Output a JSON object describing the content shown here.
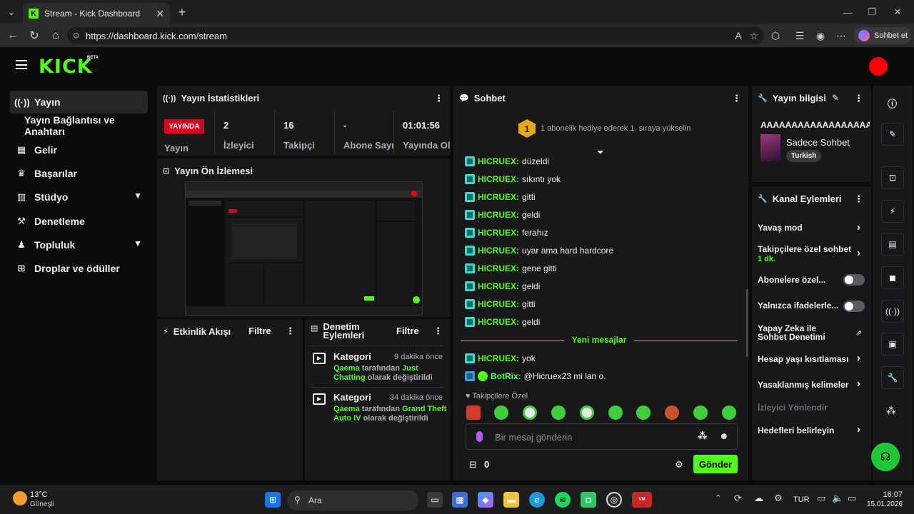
{
  "browser": {
    "tab_title": "Stream - Kick Dashboard",
    "url": "https://dashboard.kick.com/stream",
    "copilot_label": "Sohbet et"
  },
  "app": {
    "logo": "KICK",
    "beta": "BETA",
    "accent": "#53fc18",
    "live_color": "#d9001e"
  },
  "sidebar": {
    "items": [
      {
        "label": "Yayın",
        "icon": "broadcast-icon"
      },
      {
        "label": "Yayın Bağlantısı ve Anahtarı",
        "icon": ""
      },
      {
        "label": "Gelir",
        "icon": "revenue-icon"
      },
      {
        "label": "Başarılar",
        "icon": "trophy-icon"
      },
      {
        "label": "Stüdyo",
        "icon": "studio-icon"
      },
      {
        "label": "Denetleme",
        "icon": "moderation-icon"
      },
      {
        "label": "Topluluk",
        "icon": "community-icon"
      },
      {
        "label": "Droplar ve ödüller",
        "icon": "drops-icon"
      }
    ]
  },
  "stats": {
    "title": "Yayın İstatistikleri",
    "live_badge": "YAYINDA",
    "live_label": "Yayın",
    "items": [
      {
        "value": "2",
        "label": "İzleyici"
      },
      {
        "value": "16",
        "label": "Takipçi"
      },
      {
        "value": "-",
        "label": "Abone Sayısı"
      },
      {
        "value": "01:01:56",
        "label": "Yayında Olduğu"
      }
    ]
  },
  "preview": {
    "title": "Yayın Ön İzlemesi"
  },
  "activity": {
    "title": "Etkinlik Akışı",
    "filter": "Filtre"
  },
  "moderation": {
    "title": "Denetim Eylemleri",
    "filter": "Filtre",
    "events": [
      {
        "type": "Kategori",
        "time": "9 dakika önce",
        "user": "Qaema",
        "mid": "tarafından",
        "target": "Just Chatting",
        "tail": "olarak değiştirildi"
      },
      {
        "type": "Kategori",
        "time": "34 dakika önce",
        "user": "Qaema",
        "mid": "tarafından",
        "target": "Grand Theft Auto IV",
        "tail": "olarak değiştirildi"
      }
    ]
  },
  "chat": {
    "title": "Sohbet",
    "gift_rank": "1",
    "gift_text": "1 abonelik hediye ederek 1. sıraya yükselin",
    "messages": [
      {
        "user": "HICRUEX:",
        "text": "düzeldi"
      },
      {
        "user": "HICRUEX:",
        "text": "sıkıntı yok"
      },
      {
        "user": "HICRUEX:",
        "text": "gitti"
      },
      {
        "user": "HICRUEX:",
        "text": "geldi"
      },
      {
        "user": "HICRUEX:",
        "text": "ferahız"
      },
      {
        "user": "HICRUEX:",
        "text": "uyar ama hard hardcore"
      },
      {
        "user": "HICRUEX:",
        "text": "gene gitti"
      },
      {
        "user": "HICRUEX:",
        "text": "geldi"
      },
      {
        "user": "HICRUEX:",
        "text": "gitti"
      },
      {
        "user": "HICRUEX:",
        "text": "geldi"
      }
    ],
    "new_messages_label": "Yeni mesajlar",
    "new_messages": [
      {
        "user": "HICRUEX:",
        "text": "yok"
      },
      {
        "user": "BotRix:",
        "text": "@Hicruex23 mi lan o."
      }
    ],
    "followers_only": "Takipçilere Özel",
    "input_placeholder": "Bir mesaj gönderin",
    "points": "0",
    "send_label": "Gönder"
  },
  "stream_info": {
    "title": "Yayın bilgisi",
    "stream_title": "AAAAAAAAAAAAAAAAAA",
    "category": "Sadece Sohbet",
    "language": "Turkish"
  },
  "channel_actions": {
    "title": "Kanal Eylemleri",
    "items": [
      {
        "label": "Yavaş mod",
        "control": "arrow"
      },
      {
        "label": "Takipçilere özel sohbet",
        "sub": "1 dk.",
        "control": "arrow"
      },
      {
        "label": "Abonelere özel...",
        "control": "toggle"
      },
      {
        "label": "Yalnızca ifadelerle...",
        "control": "toggle"
      },
      {
        "label": "Yapay Zeka ile Sohbet Denetimi",
        "control": "external"
      },
      {
        "label": "Hesap yaşı kısıtlaması",
        "control": "arrow"
      },
      {
        "label": "Yasaklanmış kelimeler",
        "control": "arrow"
      },
      {
        "label": "İzleyici Yönlendir",
        "control": "none"
      },
      {
        "label": "Hedefleri belirleyin",
        "control": "arrow"
      }
    ]
  },
  "taskbar": {
    "weather_temp": "13°C",
    "weather_desc": "Güneşli",
    "search_label": "Ara",
    "lang": "TUR",
    "time": "16:07",
    "date": "15.01.2026"
  }
}
